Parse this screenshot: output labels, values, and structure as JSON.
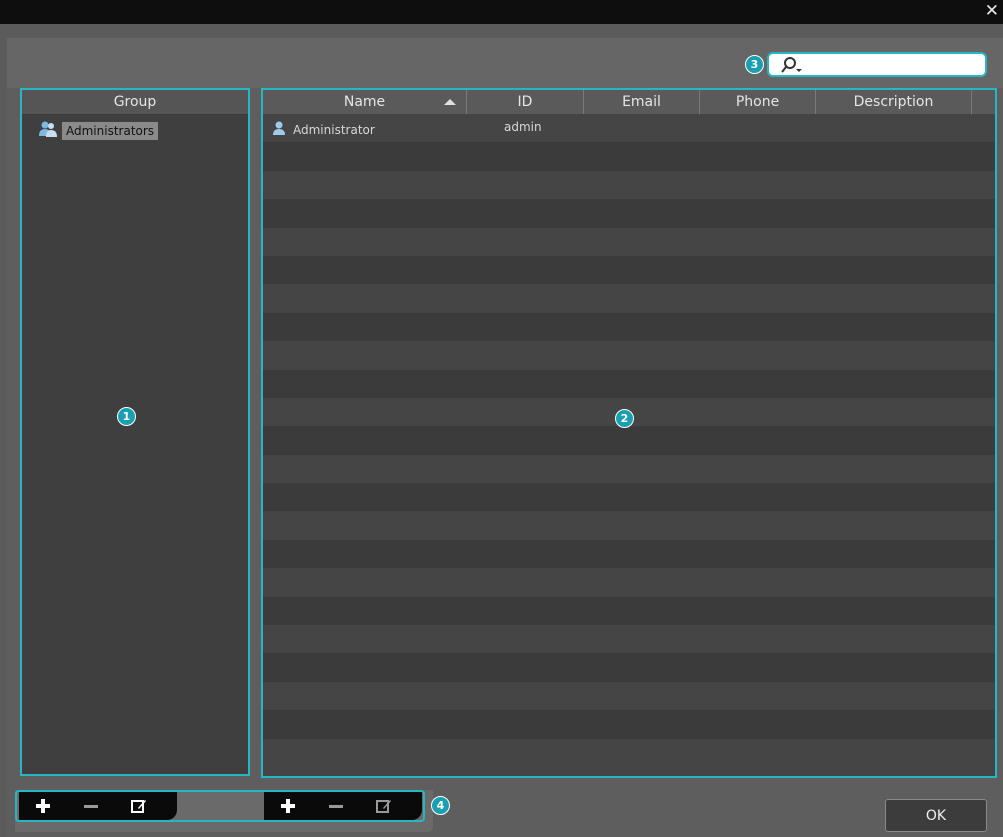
{
  "window": {
    "close_glyph": "✕"
  },
  "search": {
    "value": "",
    "placeholder": ""
  },
  "callouts": {
    "one": "1",
    "two": "2",
    "three": "3",
    "four": "4"
  },
  "groups": {
    "header": "Group",
    "items": [
      {
        "label": "Administrators",
        "icon": "user-group-icon"
      }
    ]
  },
  "users": {
    "columns": [
      "Name",
      "ID",
      "Email",
      "Phone",
      "Description"
    ],
    "sorted_column": "Name",
    "rows": [
      {
        "name": "Administrator",
        "id": "admin",
        "email": "",
        "phone": "",
        "description": "",
        "icon": "user-icon"
      }
    ]
  },
  "toolbars": {
    "group": [
      "add-icon",
      "remove-icon",
      "edit-icon"
    ],
    "user": [
      "add-icon",
      "remove-icon",
      "edit-icon"
    ]
  },
  "footer": {
    "ok_label": "OK"
  },
  "colors": {
    "accent": "#27b6c2",
    "callout": "#1a9fb0",
    "background": "#5b5b5b"
  }
}
